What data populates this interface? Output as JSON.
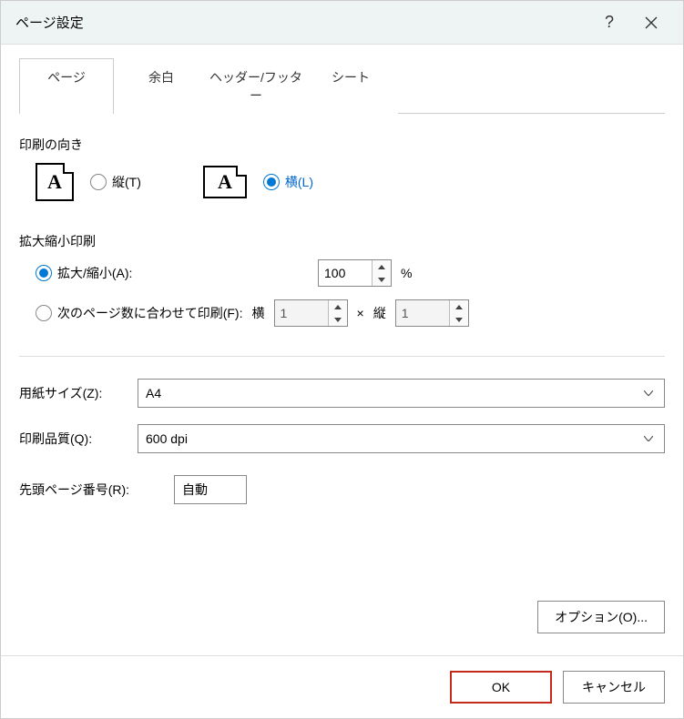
{
  "titlebar": {
    "title": "ページ設定"
  },
  "tabs": [
    {
      "label": "ページ",
      "active": true
    },
    {
      "label": "余白"
    },
    {
      "label": "ヘッダー/フッター"
    },
    {
      "label": "シート"
    }
  ],
  "orientation": {
    "section_label": "印刷の向き",
    "portrait_label": "縦(T)",
    "landscape_label": "横(L)"
  },
  "scaling": {
    "section_label": "拡大縮小印刷",
    "adjust_label": "拡大/縮小(A):",
    "adjust_value": "100",
    "adjust_suffix": "%",
    "fit_label": "次のページ数に合わせて印刷(F):",
    "fit_wide_label": "横",
    "fit_wide_value": "1",
    "fit_x": "×",
    "fit_tall_label": "縦",
    "fit_tall_value": "1"
  },
  "paper": {
    "size_label": "用紙サイズ(Z):",
    "size_value": "A4",
    "quality_label": "印刷品質(Q):",
    "quality_value": "600 dpi"
  },
  "firstpage": {
    "label": "先頭ページ番号(R):",
    "value": "自動"
  },
  "buttons": {
    "options": "オプション(O)...",
    "ok": "OK",
    "cancel": "キャンセル"
  }
}
